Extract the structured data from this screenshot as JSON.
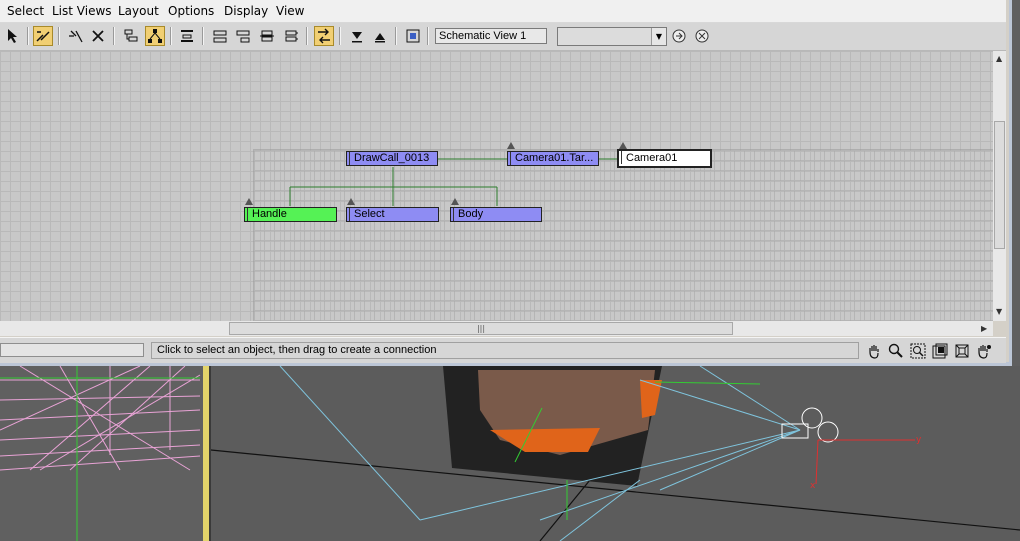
{
  "menu": {
    "items": [
      "Select",
      "List Views",
      "Layout",
      "Options",
      "Display",
      "View"
    ]
  },
  "toolbar": {
    "view_name": "Schematic View 1",
    "combo_value": ""
  },
  "schematic": {
    "nodes": {
      "drawcall": "DrawCall_0013",
      "camera_target": "Camera01.Tar...",
      "camera": "Camera01",
      "handle": "Handle",
      "select": "Select",
      "body": "Body"
    }
  },
  "status": {
    "message": "Click to select an object, then drag to create a connection"
  },
  "colors": {
    "node_blue": "#8e8cf3",
    "node_green": "#55f255",
    "wire": "#2d7d2d",
    "toggle_active": "#f1cf73"
  }
}
